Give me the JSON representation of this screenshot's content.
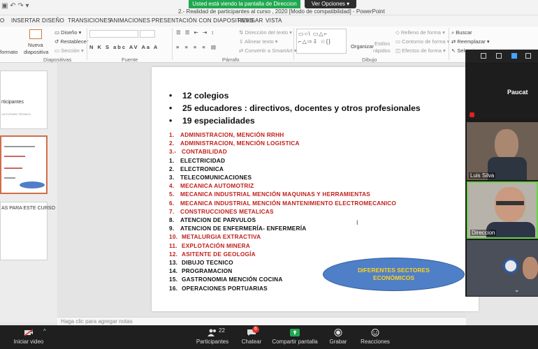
{
  "zoom": {
    "share_banner": "Usted está viendo la pantalla de Direccion",
    "view_options": "Ver Opciones",
    "toolbar": {
      "video": "Iniciar video",
      "participants": "Participantes",
      "participants_count": "22",
      "chat": "Chatear",
      "chat_badge": "6",
      "share": "Compartir pantalla",
      "record": "Grabar",
      "reactions": "Reacciones"
    },
    "gallery": {
      "tiles": [
        {
          "name": "Paucat"
        },
        {
          "name": "Luis Silva"
        },
        {
          "name": "Direccion"
        }
      ]
    },
    "colors": {
      "share_green": "#1fa84f",
      "toolbar_bg": "#1f1f1f",
      "badge_red": "#e0312f"
    }
  },
  "powerpoint": {
    "window_title": "2.- Realidad de participantes al curso , 2020 [Modo de compatibilidad] - PowerPoint",
    "tabs": [
      "O",
      "INSERTAR",
      "DISEÑO",
      "TRANSICIONES",
      "ANIMACIONES",
      "PRESENTACIÓN CON DIAPOSITIVAS",
      "REVISAR",
      "VISTA"
    ],
    "ribbon": {
      "format_label": "formato",
      "new_slide": "Nueva",
      "new_slide_2": "diapositiva",
      "layout": "Diseño",
      "reset": "Restablecer",
      "section": "Sección",
      "group_slides": "Diapositivas",
      "group_font": "Fuente",
      "group_paragraph": "Párrafo",
      "group_drawing": "Dibujo",
      "text_direction": "Dirección del texto",
      "align_text": "Alinear texto",
      "convert_smartart": "Convertir a SmartArt",
      "organize": "Organizar",
      "quick_styles": "Estilos",
      "quick_styles_2": "rápidos",
      "shape_fill": "Relleno de forma",
      "shape_outline": "Contorno de forma",
      "shape_effects": "Efectos de forma",
      "find": "Buscar",
      "replace": "Reemplazar",
      "select": "Seleccionar",
      "font_buttons": "N K S abc AV Aa A"
    },
    "thumbnails": [
      {
        "line1": "rticipantes",
        "line2": "CA FUTURO TÉCNICO"
      },
      {
        "line1": "",
        "line2": ""
      },
      {
        "line1": "AS PARA ESTE CURSO",
        "line2": ""
      }
    ],
    "notes_placeholder": "Haga clic para agregar notas",
    "slide": {
      "headline": [
        "12 colegios",
        "25 educadores : directivos, docentes y otros profesionales",
        "19  especialidades"
      ],
      "bullet_char": "•",
      "specialties": [
        {
          "num": "1.",
          "text": "ADMINISTRACION, MENCIÓN RRHH",
          "color": "red"
        },
        {
          "num": "2.",
          "text": "ADMINISTRACION, MENCIÓN LOGISTICA",
          "color": "red"
        },
        {
          "num": "3.-",
          "text": "CONTABILIDAD",
          "color": "red"
        },
        {
          "num": "1.",
          "text": "ELECTRICIDAD",
          "color": "black"
        },
        {
          "num": "2.",
          "text": "ELECTRONICA",
          "color": "black"
        },
        {
          "num": "3.",
          "text": "TELECOMUNICACIONES",
          "color": "black"
        },
        {
          "num": "4.",
          "text": "MECANICA AUTOMOTRIZ",
          "color": "red"
        },
        {
          "num": "5.",
          "text": "MECANICA INDUSTRIAL MENCIÓN  MAQUINAS Y HERRAMIENTAS",
          "color": "red"
        },
        {
          "num": "6.",
          "text": "MECANICA INDUSTRIAL MENCIÓN MANTENIMIENTO ELECTROMECANICO",
          "color": "red"
        },
        {
          "num": "7.",
          "text": "CONSTRUCCIONES METALICAS",
          "color": "red"
        },
        {
          "num": "8.",
          "text": "ATENCION DE PARVULOS",
          "color": "black"
        },
        {
          "num": "9.",
          "text": "ATENCION DE ENFERMERÍA- ENFERMERÍA",
          "color": "black"
        },
        {
          "num": "10.",
          "text": "METALURGIA EXTRACTIVA",
          "color": "red"
        },
        {
          "num": "11.",
          "text": "EXPLOTACIÓN MINERA",
          "color": "red"
        },
        {
          "num": "12.",
          "text": "ASITENTE DE GEOLOGÍA",
          "color": "red"
        },
        {
          "num": "13.",
          "text": "DIBUJO TECNICO",
          "color": "black"
        },
        {
          "num": "14.",
          "text": "PROGRAMACION",
          "color": "black"
        },
        {
          "num": "15.",
          "text": "GASTRONOMIA MENCIÓN COCINA",
          "color": "black"
        },
        {
          "num": "16.",
          "text": "OPERACIONES PORTUARIAS",
          "color": "black"
        }
      ],
      "callout": "DIFERENTES SECTORES ECONÓMICOS",
      "colors": {
        "red": "#c0201a",
        "black": "#111111",
        "callout_fill": "#4f7fc7",
        "callout_text": "#ffd21a"
      }
    }
  }
}
